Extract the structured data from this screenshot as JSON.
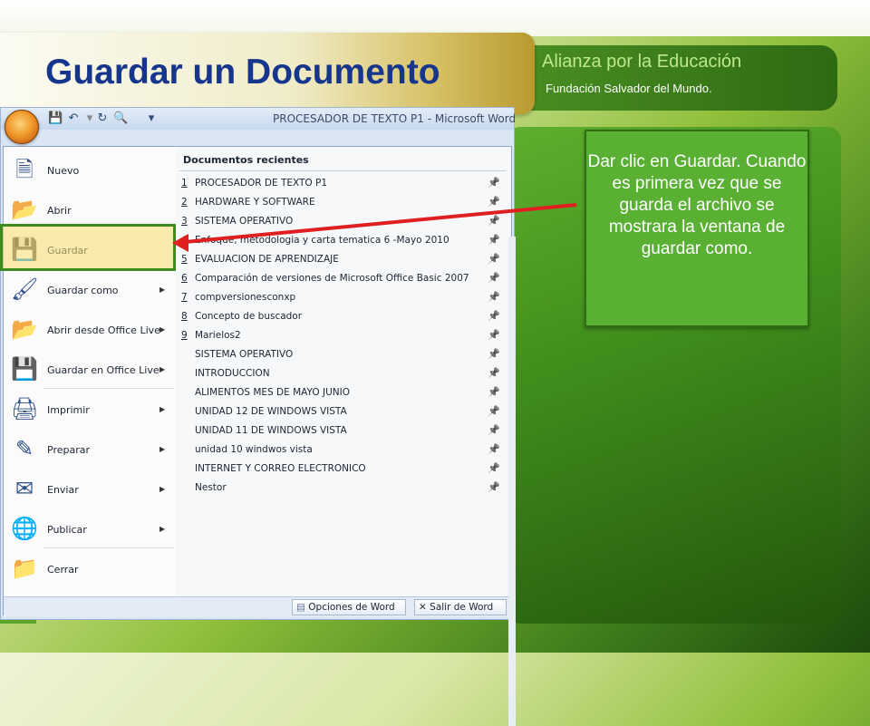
{
  "slide": {
    "title": "Guardar un Documento",
    "brand": "Alianza por la Educación",
    "brand_sub": "Fundación Salvador del Mundo.",
    "callout": "Dar clic en Guardar. Cuando es primera vez  que se guarda el archivo se mostrara  la ventana de guardar como."
  },
  "window": {
    "title": "PROCESADOR DE TEXTO P1 - Microsoft Word",
    "quick_access": [
      "save-icon",
      "undo-icon",
      "redo-icon",
      "print-preview-icon",
      "customize-icon"
    ]
  },
  "menu": {
    "items": [
      {
        "label": "Nuevo",
        "icon": "new-document-icon",
        "has_submenu": false
      },
      {
        "label": "Abrir",
        "icon": "open-folder-icon",
        "has_submenu": false
      },
      {
        "label": "Guardar",
        "icon": "save-icon",
        "has_submenu": false
      },
      {
        "label": "Guardar como",
        "icon": "save-as-icon",
        "has_submenu": true
      },
      {
        "label": "Abrir desde Office Live",
        "icon": "open-live-icon",
        "has_submenu": true
      },
      {
        "label": "Guardar en Office Live",
        "icon": "save-live-icon",
        "has_submenu": true
      },
      {
        "label": "Imprimir",
        "icon": "printer-icon",
        "has_submenu": true
      },
      {
        "label": "Preparar",
        "icon": "prepare-icon",
        "has_submenu": true
      },
      {
        "label": "Enviar",
        "icon": "send-icon",
        "has_submenu": true
      },
      {
        "label": "Publicar",
        "icon": "publish-icon",
        "has_submenu": true
      },
      {
        "label": "Cerrar",
        "icon": "close-folder-icon",
        "has_submenu": false
      }
    ],
    "recent_header": "Documentos recientes",
    "recent": [
      {
        "num": "1",
        "name": "PROCESADOR DE TEXTO P1"
      },
      {
        "num": "2",
        "name": "HARDWARE Y SOFTWARE"
      },
      {
        "num": "3",
        "name": "SISTEMA OPERATIVO"
      },
      {
        "num": "4",
        "name": "Enfoque, metodologia y carta tematica 6 -Mayo 2010"
      },
      {
        "num": "5",
        "name": "EVALUACION DE APRENDIZAJE"
      },
      {
        "num": "6",
        "name": "Comparación de versiones de Microsoft Office Basic 2007"
      },
      {
        "num": "7",
        "name": "compversionesconxp"
      },
      {
        "num": "8",
        "name": "Concepto de buscador"
      },
      {
        "num": "9",
        "name": "Marielos2"
      },
      {
        "num": "",
        "name": "SISTEMA OPERATIVO"
      },
      {
        "num": "",
        "name": "INTRODUCCION"
      },
      {
        "num": "",
        "name": "ALIMENTOS MES DE MAYO JUNIO"
      },
      {
        "num": "",
        "name": "UNIDAD 12 DE WINDOWS VISTA"
      },
      {
        "num": "",
        "name": "UNIDAD 11 DE WINDOWS VISTA"
      },
      {
        "num": "",
        "name": "unidad 10 windwos vista"
      },
      {
        "num": "",
        "name": "INTERNET Y CORREO ELECTRONICO"
      },
      {
        "num": "",
        "name": "Nestor"
      }
    ],
    "options_button": "Opciones de Word",
    "exit_button": "Salir de Word"
  },
  "colors": {
    "title": "#16358c",
    "brand": "#bde88c",
    "callout_bg": "#59b033",
    "highlight_border": "#3d8a1d",
    "arrow": "#e02020"
  }
}
